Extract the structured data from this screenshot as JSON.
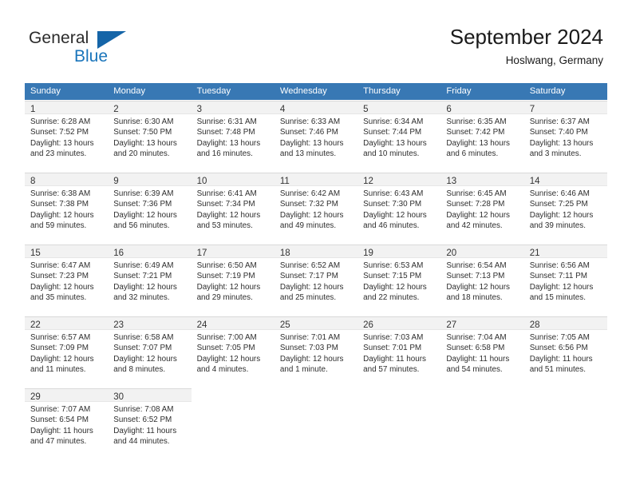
{
  "brand": {
    "name_part1": "General",
    "name_part2": "Blue",
    "triangle_color": "#1565a8",
    "blue_color": "#1a75bb"
  },
  "header": {
    "title": "September 2024",
    "location": "Hoslwang, Germany"
  },
  "theme": {
    "header_row_bg": "#3878b4",
    "header_row_text": "#ffffff",
    "daynum_band_bg": "#f2f2f2",
    "cell_text": "#2e2e2e"
  },
  "weekday_headers": [
    "Sunday",
    "Monday",
    "Tuesday",
    "Wednesday",
    "Thursday",
    "Friday",
    "Saturday"
  ],
  "weeks": [
    [
      {
        "day": "1",
        "sunrise": "Sunrise: 6:28 AM",
        "sunset": "Sunset: 7:52 PM",
        "daylight_line1": "Daylight: 13 hours",
        "daylight_line2": "and 23 minutes."
      },
      {
        "day": "2",
        "sunrise": "Sunrise: 6:30 AM",
        "sunset": "Sunset: 7:50 PM",
        "daylight_line1": "Daylight: 13 hours",
        "daylight_line2": "and 20 minutes."
      },
      {
        "day": "3",
        "sunrise": "Sunrise: 6:31 AM",
        "sunset": "Sunset: 7:48 PM",
        "daylight_line1": "Daylight: 13 hours",
        "daylight_line2": "and 16 minutes."
      },
      {
        "day": "4",
        "sunrise": "Sunrise: 6:33 AM",
        "sunset": "Sunset: 7:46 PM",
        "daylight_line1": "Daylight: 13 hours",
        "daylight_line2": "and 13 minutes."
      },
      {
        "day": "5",
        "sunrise": "Sunrise: 6:34 AM",
        "sunset": "Sunset: 7:44 PM",
        "daylight_line1": "Daylight: 13 hours",
        "daylight_line2": "and 10 minutes."
      },
      {
        "day": "6",
        "sunrise": "Sunrise: 6:35 AM",
        "sunset": "Sunset: 7:42 PM",
        "daylight_line1": "Daylight: 13 hours",
        "daylight_line2": "and 6 minutes."
      },
      {
        "day": "7",
        "sunrise": "Sunrise: 6:37 AM",
        "sunset": "Sunset: 7:40 PM",
        "daylight_line1": "Daylight: 13 hours",
        "daylight_line2": "and 3 minutes."
      }
    ],
    [
      {
        "day": "8",
        "sunrise": "Sunrise: 6:38 AM",
        "sunset": "Sunset: 7:38 PM",
        "daylight_line1": "Daylight: 12 hours",
        "daylight_line2": "and 59 minutes."
      },
      {
        "day": "9",
        "sunrise": "Sunrise: 6:39 AM",
        "sunset": "Sunset: 7:36 PM",
        "daylight_line1": "Daylight: 12 hours",
        "daylight_line2": "and 56 minutes."
      },
      {
        "day": "10",
        "sunrise": "Sunrise: 6:41 AM",
        "sunset": "Sunset: 7:34 PM",
        "daylight_line1": "Daylight: 12 hours",
        "daylight_line2": "and 53 minutes."
      },
      {
        "day": "11",
        "sunrise": "Sunrise: 6:42 AM",
        "sunset": "Sunset: 7:32 PM",
        "daylight_line1": "Daylight: 12 hours",
        "daylight_line2": "and 49 minutes."
      },
      {
        "day": "12",
        "sunrise": "Sunrise: 6:43 AM",
        "sunset": "Sunset: 7:30 PM",
        "daylight_line1": "Daylight: 12 hours",
        "daylight_line2": "and 46 minutes."
      },
      {
        "day": "13",
        "sunrise": "Sunrise: 6:45 AM",
        "sunset": "Sunset: 7:28 PM",
        "daylight_line1": "Daylight: 12 hours",
        "daylight_line2": "and 42 minutes."
      },
      {
        "day": "14",
        "sunrise": "Sunrise: 6:46 AM",
        "sunset": "Sunset: 7:25 PM",
        "daylight_line1": "Daylight: 12 hours",
        "daylight_line2": "and 39 minutes."
      }
    ],
    [
      {
        "day": "15",
        "sunrise": "Sunrise: 6:47 AM",
        "sunset": "Sunset: 7:23 PM",
        "daylight_line1": "Daylight: 12 hours",
        "daylight_line2": "and 35 minutes."
      },
      {
        "day": "16",
        "sunrise": "Sunrise: 6:49 AM",
        "sunset": "Sunset: 7:21 PM",
        "daylight_line1": "Daylight: 12 hours",
        "daylight_line2": "and 32 minutes."
      },
      {
        "day": "17",
        "sunrise": "Sunrise: 6:50 AM",
        "sunset": "Sunset: 7:19 PM",
        "daylight_line1": "Daylight: 12 hours",
        "daylight_line2": "and 29 minutes."
      },
      {
        "day": "18",
        "sunrise": "Sunrise: 6:52 AM",
        "sunset": "Sunset: 7:17 PM",
        "daylight_line1": "Daylight: 12 hours",
        "daylight_line2": "and 25 minutes."
      },
      {
        "day": "19",
        "sunrise": "Sunrise: 6:53 AM",
        "sunset": "Sunset: 7:15 PM",
        "daylight_line1": "Daylight: 12 hours",
        "daylight_line2": "and 22 minutes."
      },
      {
        "day": "20",
        "sunrise": "Sunrise: 6:54 AM",
        "sunset": "Sunset: 7:13 PM",
        "daylight_line1": "Daylight: 12 hours",
        "daylight_line2": "and 18 minutes."
      },
      {
        "day": "21",
        "sunrise": "Sunrise: 6:56 AM",
        "sunset": "Sunset: 7:11 PM",
        "daylight_line1": "Daylight: 12 hours",
        "daylight_line2": "and 15 minutes."
      }
    ],
    [
      {
        "day": "22",
        "sunrise": "Sunrise: 6:57 AM",
        "sunset": "Sunset: 7:09 PM",
        "daylight_line1": "Daylight: 12 hours",
        "daylight_line2": "and 11 minutes."
      },
      {
        "day": "23",
        "sunrise": "Sunrise: 6:58 AM",
        "sunset": "Sunset: 7:07 PM",
        "daylight_line1": "Daylight: 12 hours",
        "daylight_line2": "and 8 minutes."
      },
      {
        "day": "24",
        "sunrise": "Sunrise: 7:00 AM",
        "sunset": "Sunset: 7:05 PM",
        "daylight_line1": "Daylight: 12 hours",
        "daylight_line2": "and 4 minutes."
      },
      {
        "day": "25",
        "sunrise": "Sunrise: 7:01 AM",
        "sunset": "Sunset: 7:03 PM",
        "daylight_line1": "Daylight: 12 hours",
        "daylight_line2": "and 1 minute."
      },
      {
        "day": "26",
        "sunrise": "Sunrise: 7:03 AM",
        "sunset": "Sunset: 7:01 PM",
        "daylight_line1": "Daylight: 11 hours",
        "daylight_line2": "and 57 minutes."
      },
      {
        "day": "27",
        "sunrise": "Sunrise: 7:04 AM",
        "sunset": "Sunset: 6:58 PM",
        "daylight_line1": "Daylight: 11 hours",
        "daylight_line2": "and 54 minutes."
      },
      {
        "day": "28",
        "sunrise": "Sunrise: 7:05 AM",
        "sunset": "Sunset: 6:56 PM",
        "daylight_line1": "Daylight: 11 hours",
        "daylight_line2": "and 51 minutes."
      }
    ],
    [
      {
        "day": "29",
        "sunrise": "Sunrise: 7:07 AM",
        "sunset": "Sunset: 6:54 PM",
        "daylight_line1": "Daylight: 11 hours",
        "daylight_line2": "and 47 minutes."
      },
      {
        "day": "30",
        "sunrise": "Sunrise: 7:08 AM",
        "sunset": "Sunset: 6:52 PM",
        "daylight_line1": "Daylight: 11 hours",
        "daylight_line2": "and 44 minutes."
      },
      {
        "day": "",
        "sunrise": "",
        "sunset": "",
        "daylight_line1": "",
        "daylight_line2": ""
      },
      {
        "day": "",
        "sunrise": "",
        "sunset": "",
        "daylight_line1": "",
        "daylight_line2": ""
      },
      {
        "day": "",
        "sunrise": "",
        "sunset": "",
        "daylight_line1": "",
        "daylight_line2": ""
      },
      {
        "day": "",
        "sunrise": "",
        "sunset": "",
        "daylight_line1": "",
        "daylight_line2": ""
      },
      {
        "day": "",
        "sunrise": "",
        "sunset": "",
        "daylight_line1": "",
        "daylight_line2": ""
      }
    ]
  ]
}
